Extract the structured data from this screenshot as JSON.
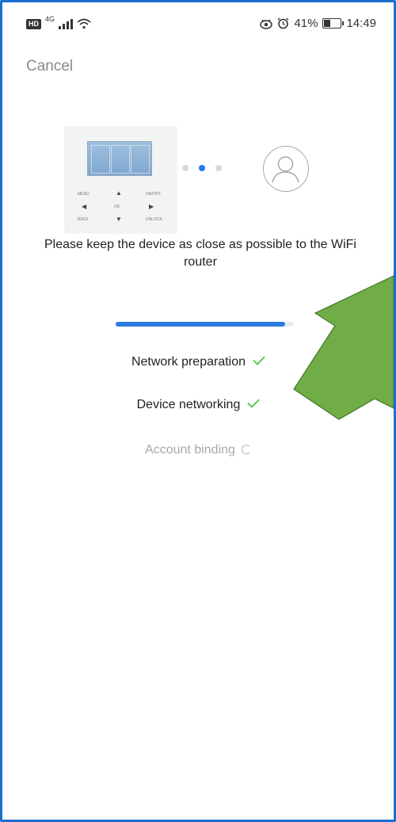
{
  "status_bar": {
    "hd_badge": "HD",
    "network": "4G",
    "battery_percent_text": "41%",
    "battery_level": 0.41,
    "time": "14:49",
    "icons": [
      "signal-icon",
      "wifi-icon",
      "eye-icon",
      "alarm-icon",
      "battery-icon"
    ]
  },
  "header": {
    "cancel_label": "Cancel"
  },
  "pairing": {
    "device_image": "thermostat-controller-image",
    "device_keys": [
      "MENU",
      "ON/OFF",
      "OK",
      "BACK",
      "UNLOCK"
    ],
    "pager_dots": 3,
    "pager_active_index": 1,
    "account_icon": "user-avatar-icon",
    "hint": "Please keep the device as close as possible to the WiFi router"
  },
  "progress": {
    "value": 0.95,
    "color": "#2d7be0"
  },
  "steps": [
    {
      "label": "Network preparation",
      "state": "done"
    },
    {
      "label": "Device networking",
      "state": "done"
    },
    {
      "label": "Account binding",
      "state": "in-progress"
    }
  ],
  "colors": {
    "accent": "#2d7be0",
    "success": "#5cc85c",
    "pending": "#a8a8a8",
    "frame": "#1b6fd1",
    "annotation_arrow": "#70ad47"
  }
}
